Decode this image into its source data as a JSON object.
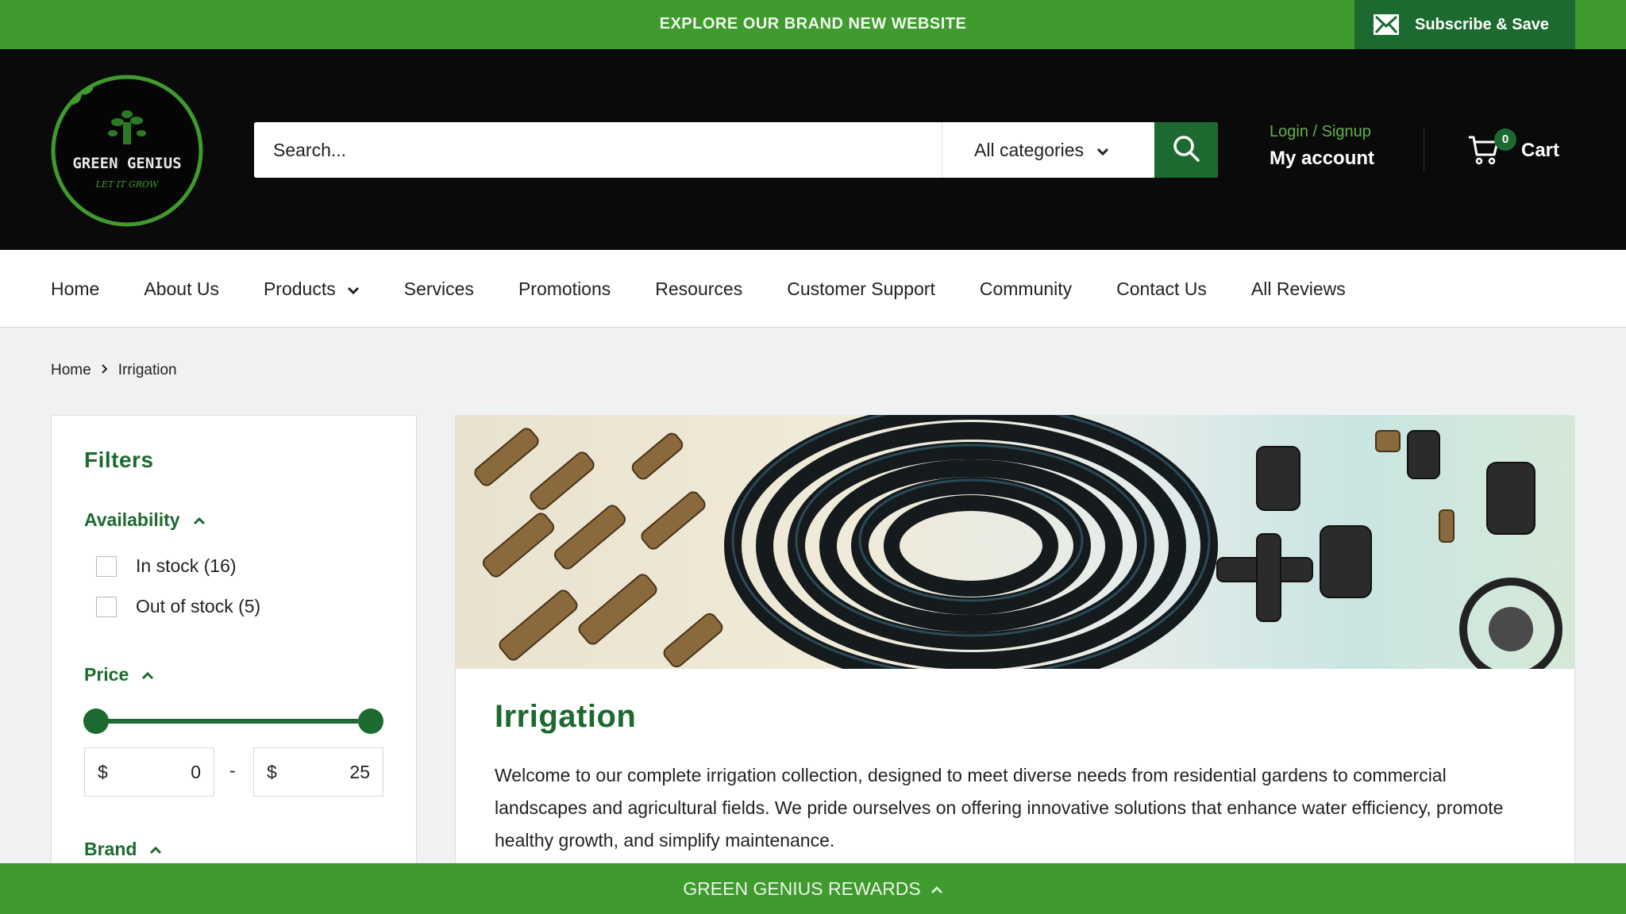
{
  "announcement": {
    "text": "EXPLORE OUR BRAND NEW WEBSITE",
    "subscribe_label": "Subscribe & Save",
    "subscribe_icon": "envelope-icon"
  },
  "brand": {
    "name": "GREEN GENIUS",
    "tagline": "LET IT GROW"
  },
  "search": {
    "placeholder": "Search...",
    "category": "All categories",
    "search_icon": "search-icon"
  },
  "account": {
    "login_label": "Login / Signup",
    "account_label": "My account"
  },
  "cart": {
    "count": "0",
    "label": "Cart",
    "icon": "cart-icon"
  },
  "nav": {
    "items": [
      {
        "label": "Home"
      },
      {
        "label": "About Us"
      },
      {
        "label": "Products"
      },
      {
        "label": "Services"
      },
      {
        "label": "Promotions"
      },
      {
        "label": "Resources"
      },
      {
        "label": "Customer Support"
      },
      {
        "label": "Community"
      },
      {
        "label": "Contact Us"
      },
      {
        "label": "All Reviews"
      }
    ]
  },
  "breadcrumb": {
    "home": "Home",
    "current": "Irrigation"
  },
  "filters": {
    "title": "Filters",
    "availability": {
      "label": "Availability",
      "options": [
        {
          "label": "In stock (16)",
          "checked": false
        },
        {
          "label": "Out of stock (5)",
          "checked": false
        }
      ]
    },
    "price": {
      "label": "Price",
      "currency": "$",
      "min": "0",
      "max": "25",
      "separator": "-"
    },
    "brand": {
      "label": "Brand"
    }
  },
  "collection": {
    "title": "Irrigation",
    "description": "Welcome to our complete irrigation collection, designed to meet diverse needs from residential gardens to commercial landscapes and agricultural fields. We pride ourselves on offering innovative solutions that enhance water efficiency, promote healthy growth, and simplify maintenance."
  },
  "rewards": {
    "label": "GREEN GENIUS REWARDS"
  },
  "colors": {
    "brand_green": "#3f9b2e",
    "dark_green": "#1c6a2f",
    "header_bg": "#0a0a0a"
  }
}
